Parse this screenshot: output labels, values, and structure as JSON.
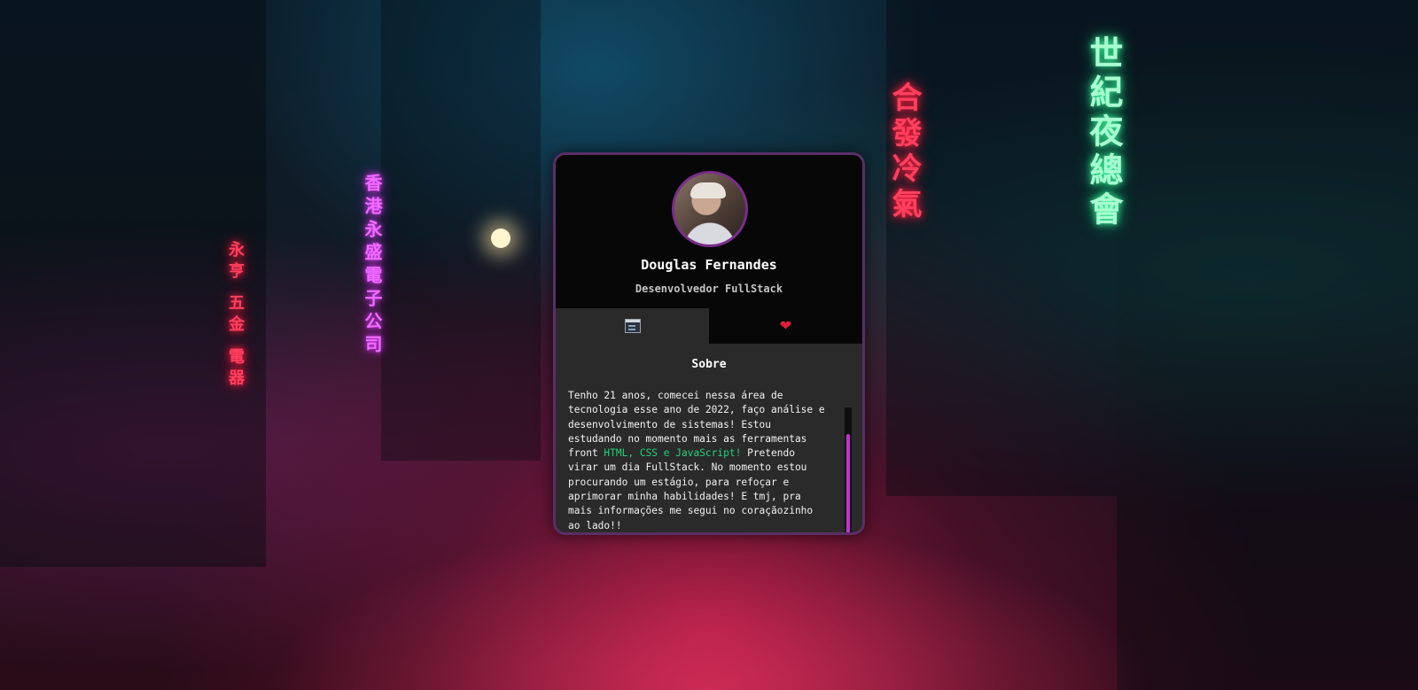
{
  "background": {
    "neon_signs": {
      "left_vertical": "香港永盛電子公司",
      "left_small": "永亨 五金 電器",
      "center_right": "合發冷氣",
      "right": "世紀夜總會"
    }
  },
  "profile": {
    "name": "Douglas Fernandes",
    "role": "Desenvolvedor FullStack",
    "avatar_icon": "avatar-photo"
  },
  "tabs": [
    {
      "icon": "window-icon",
      "active": true
    },
    {
      "icon": "heart-icon",
      "glyph": "❤",
      "active": false
    }
  ],
  "about": {
    "title": "Sobre",
    "text_before": "Tenho 21 anos, comecei nessa área de tecnologia esse ano de 2022, faço análise e desenvolvimento de sistemas! Estou estudando no momento mais as ferramentas front ",
    "highlight": "HTML, CSS e JavaScript!",
    "text_after": " Pretendo virar um dia FullStack. No momento estou procurando um estágio, para refoçar e aprimorar minha habilidades! E tmj, pra mais informações me segui no coraçãozinho ao lado!!"
  },
  "colors": {
    "accent": "#c52fcf",
    "highlight": "#26d07c",
    "card_border": "#5a2e66"
  }
}
